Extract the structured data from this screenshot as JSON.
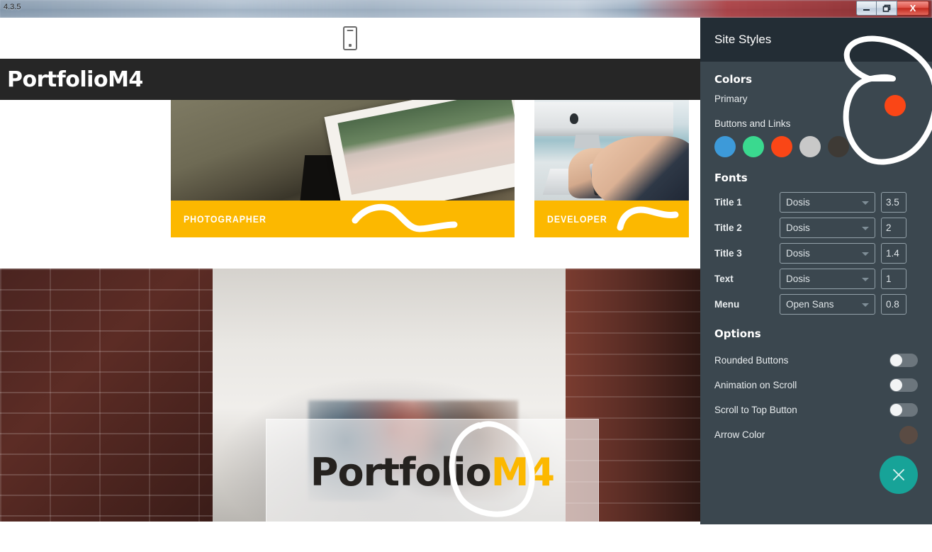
{
  "window": {
    "version_label": "4.3.5",
    "minimize_label": "—",
    "restore_label": "❐",
    "close_label": "X"
  },
  "preview": {
    "device_icon": "mobile-phone-icon",
    "site_logo": "PortfolioM4",
    "cards": [
      {
        "label": "PHOTOGRAPHER",
        "accent": "#fcb800"
      },
      {
        "label": "DEVELOPER",
        "accent": "#fcb800"
      }
    ],
    "hero": {
      "title_dark": "Portfolio",
      "title_accent": "M4"
    }
  },
  "panel": {
    "title": "Site Styles",
    "colors": {
      "heading": "Colors",
      "primary_label": "Primary",
      "primary_color": "#fa4616",
      "buttons_label": "Buttons and Links",
      "button_colors": [
        "#3d9ad9",
        "#3ad98f",
        "#fa4616",
        "#c8c8c8",
        "#3e3a35"
      ]
    },
    "fonts": {
      "heading": "Fonts",
      "rows": [
        {
          "label": "Title 1",
          "font": "Dosis",
          "size": "3.5"
        },
        {
          "label": "Title 2",
          "font": "Dosis",
          "size": "2"
        },
        {
          "label": "Title 3",
          "font": "Dosis",
          "size": "1.4"
        },
        {
          "label": "Text",
          "font": "Dosis",
          "size": "1"
        },
        {
          "label": "Menu",
          "font": "Open Sans",
          "size": "0.8"
        }
      ]
    },
    "options": {
      "heading": "Options",
      "toggles": [
        {
          "label": "Rounded Buttons",
          "on": false
        },
        {
          "label": "Animation on Scroll",
          "on": false
        },
        {
          "label": "Scroll to Top Button",
          "on": false
        }
      ],
      "arrow_color_label": "Arrow Color",
      "arrow_color": "#5a4b43"
    },
    "close_button_color": "#17a398"
  }
}
